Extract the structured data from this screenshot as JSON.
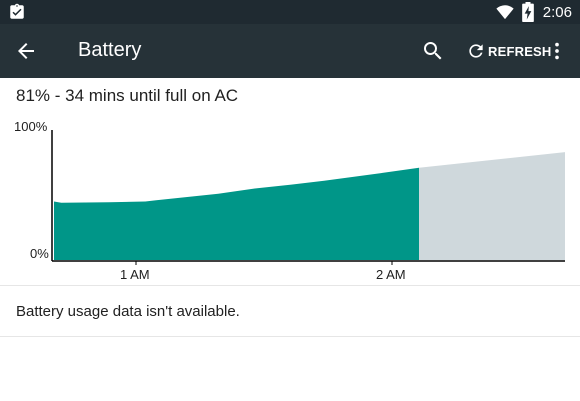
{
  "status_bar": {
    "left_icon": "clipboard-check-icon",
    "icons": [
      "wifi-icon",
      "battery-charging-icon"
    ],
    "time": "2:06"
  },
  "toolbar": {
    "title": "Battery",
    "back_icon": "arrow-back-icon",
    "search_icon": "search-icon",
    "refresh_label": "REFRESH",
    "overflow_icon": "more-vert-icon"
  },
  "battery_status": "81% - 34 mins until full on AC",
  "usage_message": "Battery usage data isn't available.",
  "colors": {
    "status_bar": "#1f2a31",
    "toolbar": "#263238",
    "history_fill": "#009688",
    "projection_fill": "#cfd8dc"
  },
  "chart_data": {
    "type": "area",
    "y_labels": [
      "100%",
      "0%"
    ],
    "x_ticks": [
      "1 AM",
      "2 AM"
    ],
    "ylim": [
      0,
      100
    ],
    "series": [
      {
        "values": [
          [
            0.0,
            45
          ],
          [
            0.02,
            44
          ],
          [
            0.15,
            44.5
          ],
          [
            0.25,
            45
          ],
          [
            0.28,
            46
          ],
          [
            0.45,
            51
          ],
          [
            0.5,
            53
          ],
          [
            0.55,
            55
          ],
          [
            0.65,
            58
          ],
          [
            0.74,
            61
          ],
          [
            0.9,
            67
          ],
          [
            1.0,
            71
          ]
        ]
      },
      {
        "values": [
          [
            1.0,
            71
          ],
          [
            1.4,
            83
          ]
        ]
      }
    ]
  }
}
